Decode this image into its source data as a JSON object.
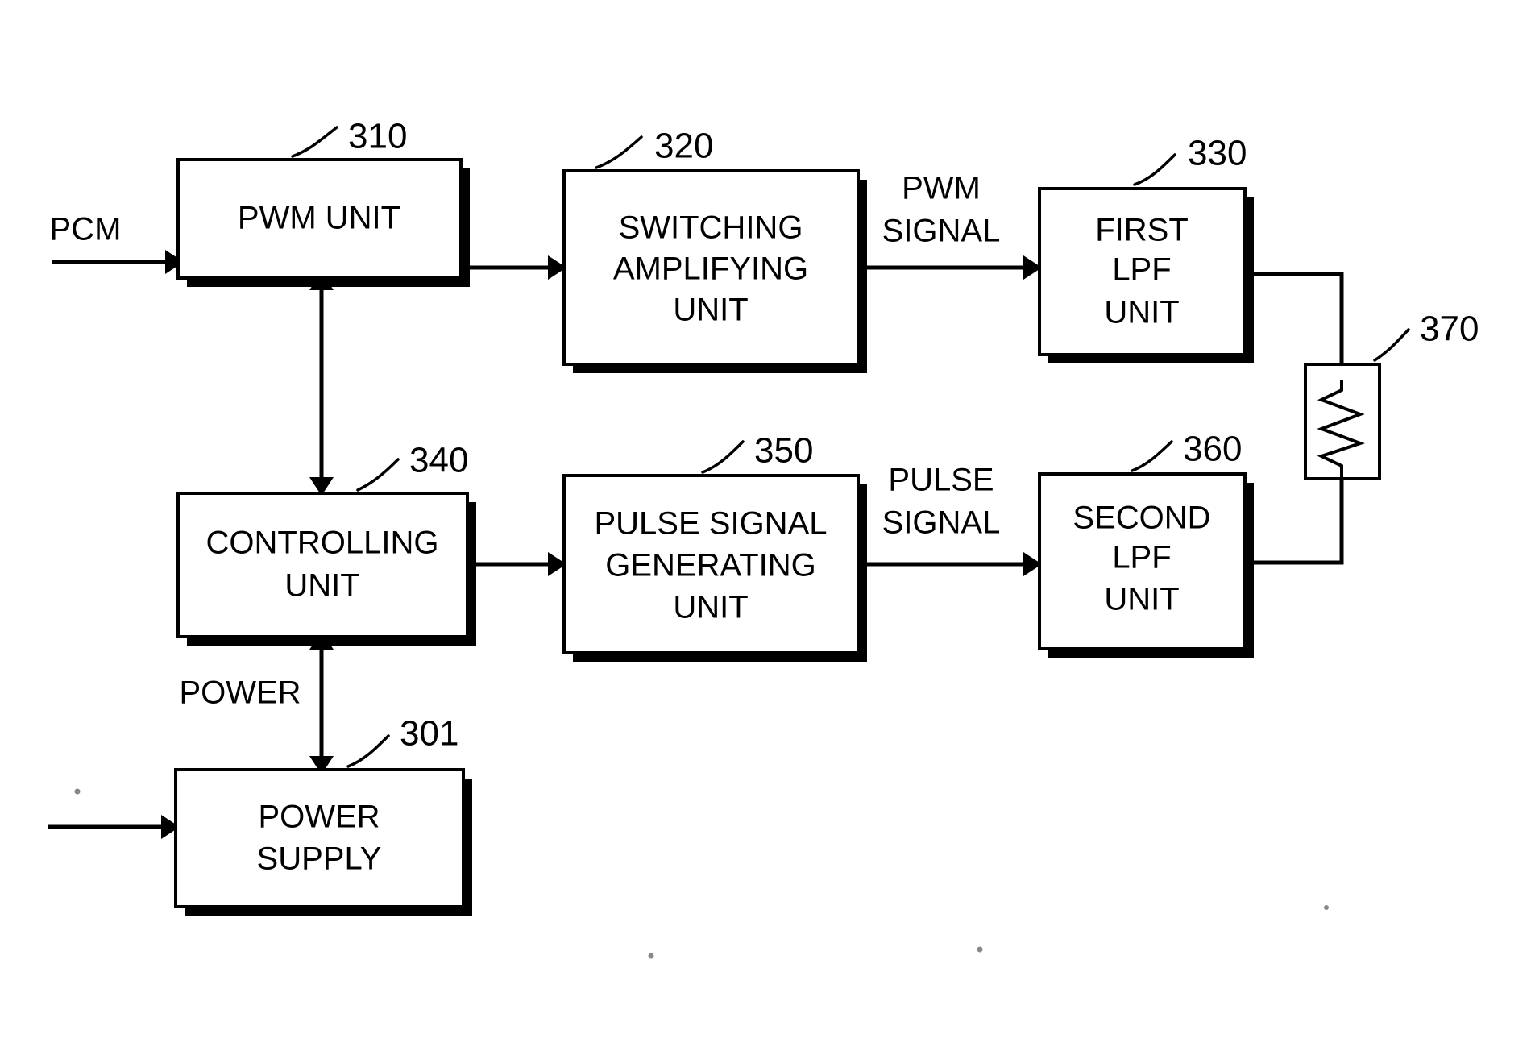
{
  "figure": {
    "type": "patent-block-diagram",
    "background_color": "#ffffff",
    "line_color": "#000000"
  },
  "blocks": [
    {
      "id": "pwm-unit",
      "ref": "310",
      "lines": [
        "PWM UNIT"
      ]
    },
    {
      "id": "switching-amplifying-unit",
      "ref": "320",
      "lines": [
        "SWITCHING",
        "AMPLIFYING",
        "UNIT"
      ]
    },
    {
      "id": "first-lpf-unit",
      "ref": "330",
      "lines": [
        "FIRST",
        "LPF",
        "UNIT"
      ]
    },
    {
      "id": "controlling-unit",
      "ref": "340",
      "lines": [
        "CONTROLLING",
        "UNIT"
      ]
    },
    {
      "id": "pulse-signal-generating-unit",
      "ref": "350",
      "lines": [
        "PULSE SIGNAL",
        "GENERATING",
        "UNIT"
      ]
    },
    {
      "id": "second-lpf-unit",
      "ref": "360",
      "lines": [
        "SECOND",
        "LPF",
        "UNIT"
      ]
    },
    {
      "id": "power-supply",
      "ref": "301",
      "lines": [
        "POWER",
        "SUPPLY"
      ]
    },
    {
      "id": "load-resistor",
      "ref": "370",
      "lines": []
    }
  ],
  "labels": {
    "pcm_input": "PCM",
    "pwm_signal": [
      "PWM",
      "SIGNAL"
    ],
    "pulse_signal": [
      "PULSE",
      "SIGNAL"
    ],
    "power": "POWER"
  },
  "block_text": {
    "pwm_unit_l1": "PWM UNIT",
    "switching_l1": "SWITCHING",
    "switching_l2": "AMPLIFYING",
    "switching_l3": "UNIT",
    "first_lpf_l1": "FIRST",
    "first_lpf_l2": "LPF",
    "first_lpf_l3": "UNIT",
    "controlling_l1": "CONTROLLING",
    "controlling_l2": "UNIT",
    "pulse_gen_l1": "PULSE SIGNAL",
    "pulse_gen_l2": "GENERATING",
    "pulse_gen_l3": "UNIT",
    "second_lpf_l1": "SECOND",
    "second_lpf_l2": "LPF",
    "second_lpf_l3": "UNIT",
    "power_supply_l1": "POWER",
    "power_supply_l2": "SUPPLY"
  },
  "ref_numbers": {
    "pwm_unit": "310",
    "switching": "320",
    "first_lpf": "330",
    "controlling": "340",
    "pulse_gen": "350",
    "second_lpf": "360",
    "resistor": "370",
    "power_supply": "301"
  },
  "signal_text": {
    "pcm": "PCM",
    "pwm_signal_l1": "PWM",
    "pwm_signal_l2": "SIGNAL",
    "pulse_signal_l1": "PULSE",
    "pulse_signal_l2": "SIGNAL",
    "power": "POWER"
  }
}
